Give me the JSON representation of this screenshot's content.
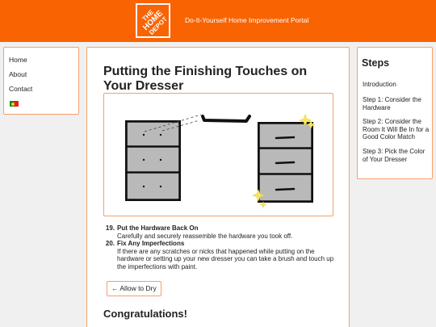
{
  "header": {
    "logo_lines": [
      "THE",
      "HOME",
      "DEPOT"
    ],
    "portal_title": "Do-It-Yourself Home Improvement Portal",
    "brand_color": "#f96302"
  },
  "left_nav": {
    "items": [
      {
        "label": "Home"
      },
      {
        "label": "About"
      },
      {
        "label": "Contact"
      }
    ],
    "language_flag": "portugal-flag-icon"
  },
  "main": {
    "title": "Putting the Finishing Touches on Your Dresser",
    "figure_icon": "dresser-illustration",
    "steps": [
      {
        "number": "19.",
        "heading": "Put the Hardware Back On",
        "description": "Carefully and securely reassemble the hardware you took off."
      },
      {
        "number": "20.",
        "heading": "Fix Any Imperfections",
        "description": "If there are any scratches or nicks that happened while putting on the hardware or setting up your new dresser you can take a brush and touch up the imperfections with paint."
      }
    ],
    "back_button": "← Allow to Dry",
    "congrats": "Congratulations!"
  },
  "right_nav": {
    "title": "Steps",
    "items": [
      {
        "label": "Introduction"
      },
      {
        "label": "Step 1: Consider the Hardware"
      },
      {
        "label": "Step 2: Consider the Room It Will Be In for a Good Color Match"
      },
      {
        "label": "Step 3: Pick the Color of Your Dresser"
      }
    ]
  },
  "colors": {
    "accent": "#f96302",
    "border": "#f5a06a",
    "dresser_gray": "#b9b9b9"
  }
}
